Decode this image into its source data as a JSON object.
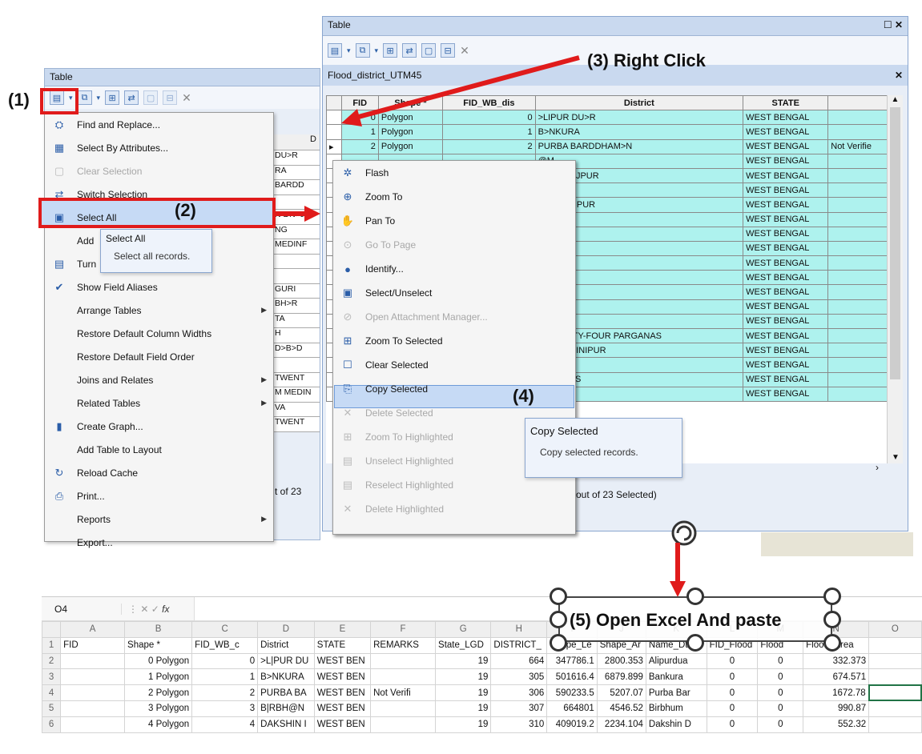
{
  "left_window": {
    "title": "Table",
    "tooltip": {
      "title": "Select All",
      "desc": "Select all records."
    },
    "menu_items": [
      {
        "label": "Find and Replace...",
        "icon": "binoculars-icon",
        "glyph": "⛭",
        "disabled": false,
        "submenu": false
      },
      {
        "label": "Select By Attributes...",
        "icon": "select-attributes-icon",
        "glyph": "▦",
        "disabled": false,
        "submenu": false
      },
      {
        "label": "Clear Selection",
        "icon": "clear-selection-icon",
        "glyph": "▢",
        "disabled": true,
        "submenu": false
      },
      {
        "label": "Switch Selection",
        "icon": "switch-selection-icon",
        "glyph": "⇄",
        "disabled": false,
        "submenu": false
      },
      {
        "label": "Select All",
        "icon": "select-all-icon",
        "glyph": "▣",
        "disabled": false,
        "submenu": false
      },
      {
        "label": "Add",
        "icon": "",
        "glyph": "",
        "disabled": false,
        "submenu": false
      },
      {
        "label": "Turn",
        "icon": "turn-icon",
        "glyph": "▤",
        "disabled": false,
        "submenu": false
      },
      {
        "label": "Show Field Aliases",
        "icon": "checkmark-icon",
        "glyph": "✔",
        "disabled": false,
        "submenu": false
      },
      {
        "label": "Arrange Tables",
        "icon": "",
        "glyph": "",
        "disabled": false,
        "submenu": true
      },
      {
        "label": "Restore Default Column Widths",
        "icon": "",
        "glyph": "",
        "disabled": false,
        "submenu": false
      },
      {
        "label": "Restore Default Field Order",
        "icon": "",
        "glyph": "",
        "disabled": false,
        "submenu": false
      },
      {
        "label": "Joins and Relates",
        "icon": "",
        "glyph": "",
        "disabled": false,
        "submenu": true
      },
      {
        "label": "Related Tables",
        "icon": "",
        "glyph": "",
        "disabled": false,
        "submenu": true
      },
      {
        "label": "Create Graph...",
        "icon": "graph-icon",
        "glyph": "▮",
        "disabled": false,
        "submenu": false
      },
      {
        "label": "Add Table to Layout",
        "icon": "",
        "glyph": "",
        "disabled": false,
        "submenu": false
      },
      {
        "label": "Reload Cache",
        "icon": "reload-icon",
        "glyph": "↻",
        "disabled": false,
        "submenu": false
      },
      {
        "label": "Print...",
        "icon": "printer-icon",
        "glyph": "⎙",
        "disabled": false,
        "submenu": false
      },
      {
        "label": "Reports",
        "icon": "",
        "glyph": "",
        "disabled": false,
        "submenu": true
      },
      {
        "label": "Export...",
        "icon": "",
        "glyph": "",
        "disabled": false,
        "submenu": false
      }
    ],
    "bg_column_header": "D",
    "bg_cells": [
      "DU>R",
      "RA",
      "BARDD",
      "",
      "N DN>J",
      "NG",
      "MEDINF",
      "",
      "",
      "GURI",
      "BH>R",
      "TA",
      "H",
      "D>B>D",
      "",
      "TWENT",
      "M MEDIN",
      "VA",
      "TWENT"
    ],
    "bg_status": "t of 23"
  },
  "right_window": {
    "title": "Table",
    "layer_tab": "Flood_district_UTM45",
    "columns": [
      "FID",
      "Shape *",
      "FID_WB_dis",
      "District",
      "STATE",
      ""
    ],
    "rows": [
      [
        "0",
        "Polygon",
        "0",
        ">LIPUR DU>R",
        "WEST BENGAL",
        ""
      ],
      [
        "1",
        "Polygon",
        "1",
        "B>NKURA",
        "WEST BENGAL",
        ""
      ],
      [
        "2",
        "Polygon",
        "2",
        "PURBA BARDDHAM>N",
        "WEST BENGAL",
        "Not Verifie"
      ]
    ],
    "bg_district": [
      "",
      "",
      "",
      "@M",
      "HIN DIN>JPUR",
      "ING",
      "A MEDINIPUR",
      "A",
      "",
      "GURI",
      "BH>R",
      ">TA",
      "AH",
      "HID>B>D",
      "A",
      "H TWENTY-FOUR PARGANAS",
      "HIM MEDINIPUR",
      "",
      "ARGANAS",
      ""
    ],
    "state_fill": "WEST BENGAL",
    "status": "out of 23 Selected)"
  },
  "context_menu": {
    "items": [
      {
        "label": "Flash",
        "icon": "flash-icon",
        "glyph": "✲",
        "disabled": false
      },
      {
        "label": "Zoom To",
        "icon": "zoom-to-icon",
        "glyph": "⊕",
        "disabled": false
      },
      {
        "label": "Pan To",
        "icon": "hand-icon",
        "glyph": "✋",
        "disabled": false
      },
      {
        "label": "Go To Page",
        "icon": "go-to-page-icon",
        "glyph": "⊙",
        "disabled": true
      },
      {
        "label": "Identify...",
        "icon": "identify-icon",
        "glyph": "●",
        "disabled": false
      },
      {
        "label": "Select/Unselect",
        "icon": "select-unselect-icon",
        "glyph": "▣",
        "disabled": false
      },
      {
        "label": "Open Attachment Manager...",
        "icon": "attachment-icon",
        "glyph": "⊘",
        "disabled": true
      },
      {
        "label": "Zoom To Selected",
        "icon": "zoom-selected-icon",
        "glyph": "⊞",
        "disabled": false
      },
      {
        "label": "Clear Selected",
        "icon": "clear-selected-icon",
        "glyph": "☐",
        "disabled": false
      },
      {
        "label": "Copy Selected",
        "icon": "copy-selected-icon",
        "glyph": "⎘",
        "disabled": false
      },
      {
        "label": "Delete Selected",
        "icon": "delete-icon",
        "glyph": "✕",
        "disabled": true
      },
      {
        "label": "Zoom To Highlighted",
        "icon": "zoom-highlighted-icon",
        "glyph": "⊞",
        "disabled": true
      },
      {
        "label": "Unselect Highlighted",
        "icon": "unselect-highlighted-icon",
        "glyph": "▤",
        "disabled": true
      },
      {
        "label": "Reselect Highlighted",
        "icon": "reselect-highlighted-icon",
        "glyph": "▤",
        "disabled": true
      },
      {
        "label": "Delete Highlighted",
        "icon": "delete-highlighted-icon",
        "glyph": "✕",
        "disabled": true
      }
    ],
    "tooltip": {
      "title": "Copy Selected",
      "desc": "Copy selected records."
    }
  },
  "callouts": {
    "step1": "(1)",
    "step2": "(2)",
    "step3": "(3) Right Click",
    "step4": "(4)",
    "step5": "(5) Open Excel And paste"
  },
  "excel": {
    "name_box": "O4",
    "fx": "fx",
    "col_letters": [
      "",
      "A",
      "B",
      "C",
      "D",
      "E",
      "F",
      "G",
      "H",
      "I",
      "J",
      "K",
      "L",
      "M",
      "N",
      "O"
    ],
    "header_row": [
      "1",
      "FID",
      "Shape *",
      "FID_WB_c",
      "District",
      "STATE",
      "REMARKS",
      "State_LGD",
      "DISTRICT_",
      "Shape_Le",
      "Shape_Ar",
      "Name_Dt",
      "FID_Flood",
      "Flood",
      "Flood_Area",
      ""
    ],
    "rows": [
      [
        "2",
        "",
        "0 Polygon",
        "0",
        ">L|PUR DU",
        "WEST BEN",
        "",
        "19",
        "664",
        "347786.1",
        "2800.353",
        "Alipurdua",
        "0",
        "0",
        "332.373",
        ""
      ],
      [
        "3",
        "",
        "1 Polygon",
        "1",
        "B>NKURA",
        "WEST BEN",
        "",
        "19",
        "305",
        "501616.4",
        "6879.899",
        "Bankura",
        "0",
        "0",
        "674.571",
        ""
      ],
      [
        "4",
        "",
        "2 Polygon",
        "2",
        "PURBA BA",
        "WEST BEN",
        "Not Verifi",
        "19",
        "306",
        "590233.5",
        "5207.07",
        "Purba Bar",
        "0",
        "0",
        "1672.78",
        ""
      ],
      [
        "5",
        "",
        "3 Polygon",
        "3",
        "B|RBH@N",
        "WEST BEN",
        "",
        "19",
        "307",
        "664801",
        "4546.52",
        "Birbhum",
        "0",
        "0",
        "990.87",
        ""
      ],
      [
        "6",
        "",
        "4 Polygon",
        "4",
        "DAKSHIN I",
        "WEST BEN",
        "",
        "19",
        "310",
        "409019.2",
        "2234.104",
        "Dakshin D",
        "0",
        "0",
        "552.32",
        ""
      ]
    ]
  },
  "colors": {
    "arrow_red": "#e01b1b",
    "cyan_row": "#aef2ee",
    "highlight_blue": "#c6daf5"
  }
}
